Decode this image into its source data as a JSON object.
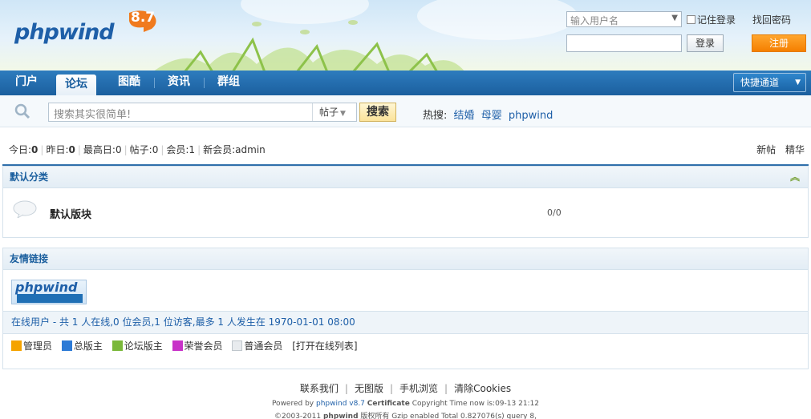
{
  "header": {
    "logo_text": "phpwind",
    "version": "8.7",
    "username_placeholder": "输入用户名",
    "remember_label": "记住登录",
    "forgot_label": "找回密码",
    "login_label": "登录",
    "register_label": "注册"
  },
  "nav": {
    "items": [
      {
        "label": "门户"
      },
      {
        "label": "论坛"
      },
      {
        "label": "图酷"
      },
      {
        "label": "资讯"
      },
      {
        "label": "群组"
      }
    ],
    "quick_label": "快捷通道"
  },
  "search": {
    "placeholder": "搜索其实很简单!",
    "type_label": "帖子",
    "button_label": "搜索",
    "hot_label": "热搜:",
    "hot_keywords": [
      "结婚",
      "母婴",
      "phpwind"
    ]
  },
  "stats": {
    "today_label": "今日:",
    "today_value": "0",
    "yesterday_label": "昨日:",
    "yesterday_value": "0",
    "max_label": "最高日:",
    "max_value": "0",
    "posts_label": "帖子:",
    "posts_value": "0",
    "members_label": "会员:",
    "members_value": "1",
    "newest_label": "新会员:",
    "newest_value": "admin"
  },
  "right_links": {
    "new_posts": "新帖",
    "digest": "精华"
  },
  "category": {
    "title": "默认分类",
    "forum_name": "默认版块",
    "forum_count": "0/0"
  },
  "links_section": {
    "title": "友情链接",
    "logo_text": "phpwind"
  },
  "online": {
    "text": "在线用户 - 共 1 人在线,0 位会员,1 位访客,最多 1 人发生在 1970-01-01 08:00"
  },
  "legend": {
    "items": [
      {
        "label": "管理员"
      },
      {
        "label": "总版主"
      },
      {
        "label": "论坛版主"
      },
      {
        "label": "荣誉会员"
      },
      {
        "label": "普通会员"
      }
    ],
    "open_list": "[打开在线列表]"
  },
  "footer": {
    "links": [
      "联系我们",
      "无图版",
      "手机浏览",
      "清除Cookies"
    ],
    "powered_prefix": "Powered by",
    "powered_product": "phpwind v8.7",
    "certificate": "Certificate",
    "powered_suffix": "Copyright Time now is:09-13 21:12",
    "copyright_prefix": "©2003-2011",
    "copyright_brand": "phpwind",
    "copyright_rights": "版权所有",
    "copyright_suffix": "Gzip enabled Total 0.827076(s) query 8,"
  },
  "colors": {
    "nav_blue": "#1b5f9e",
    "register_orange": "#f57f00",
    "link_blue": "#1e5fa8"
  }
}
